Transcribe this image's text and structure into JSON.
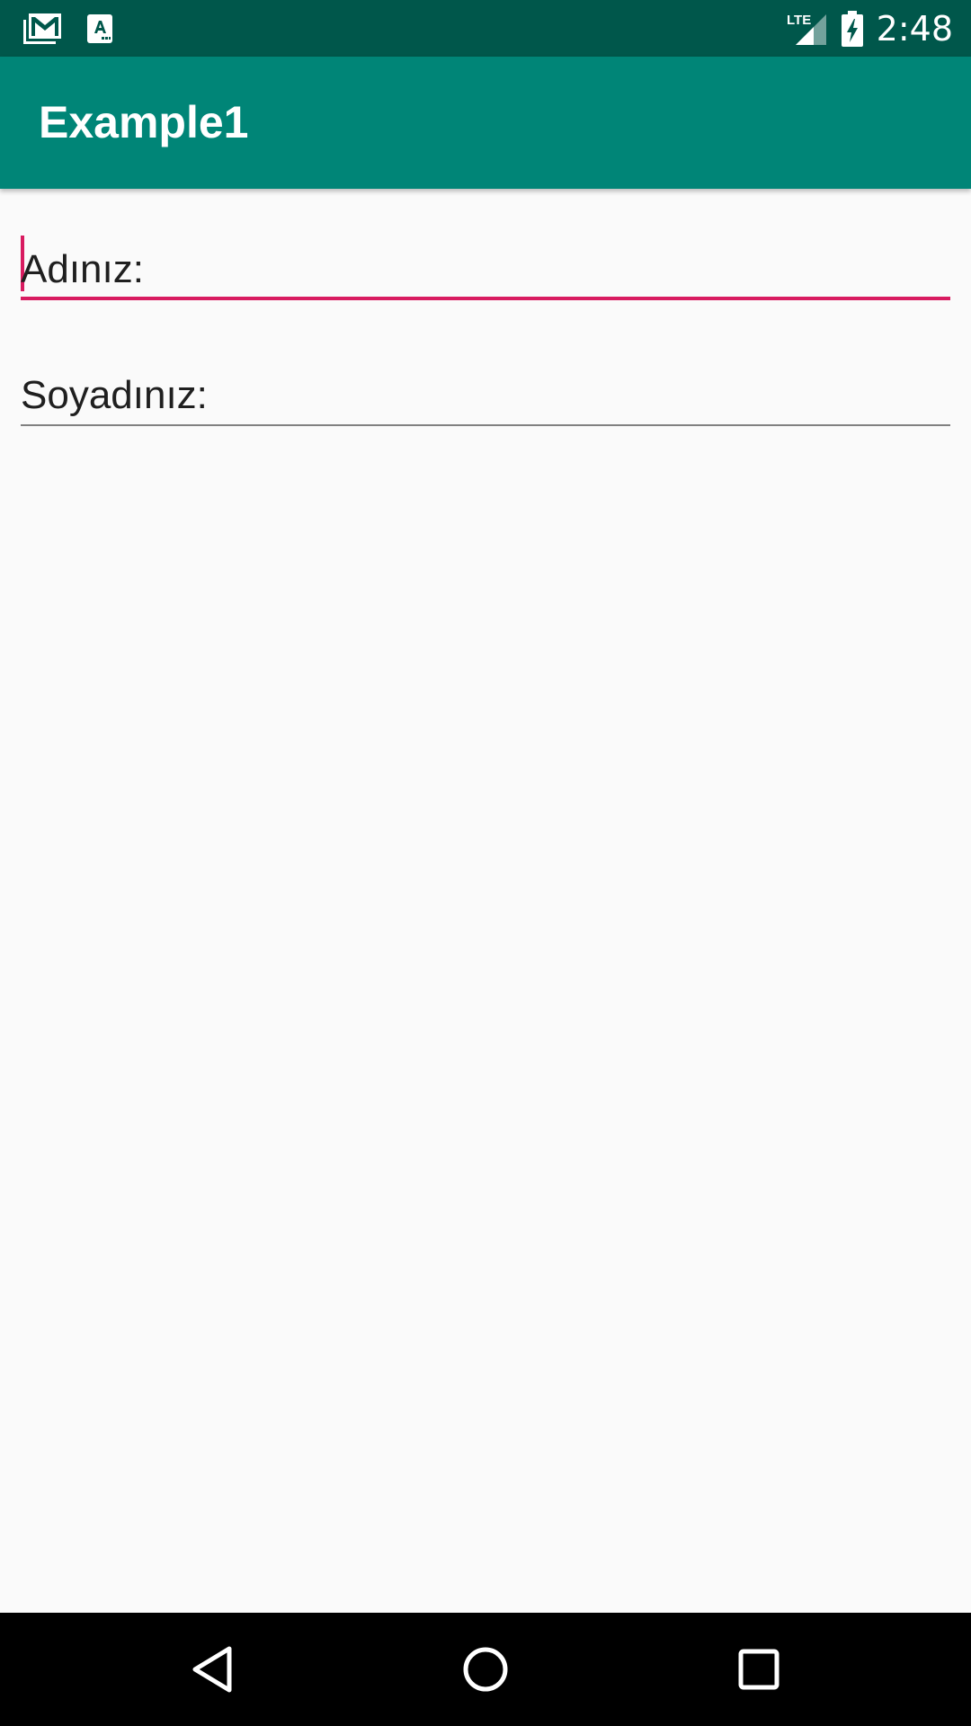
{
  "status_bar": {
    "time": "2:48",
    "network_label": "LTE",
    "left_icons": [
      "gmail-icon",
      "app-notification-icon"
    ],
    "right_icons": [
      "lte-signal-icon",
      "battery-charging-icon"
    ]
  },
  "app_bar": {
    "title": "Example1"
  },
  "form": {
    "first_name": {
      "value": "Adınız:",
      "focused": true
    },
    "last_name": {
      "value": "Soyadınız:",
      "focused": false
    }
  },
  "nav_bar": {
    "buttons": [
      "back-icon",
      "home-icon",
      "recents-icon"
    ]
  },
  "colors": {
    "status_bar": "#00574b",
    "app_bar": "#008577",
    "accent": "#d81b60",
    "background": "#fafafa"
  }
}
